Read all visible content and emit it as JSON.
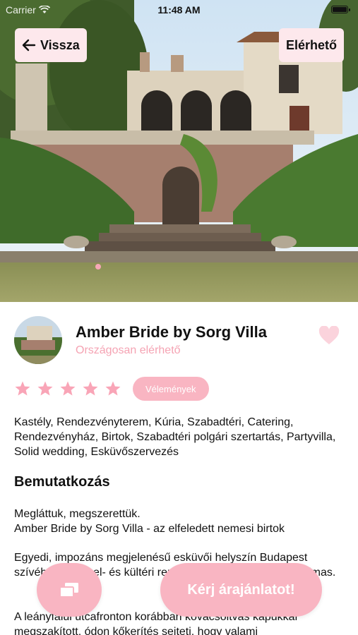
{
  "status_bar": {
    "carrier": "Carrier",
    "time": "11:48 AM"
  },
  "nav": {
    "back_label": "Vissza",
    "availability_label": "Elérhető"
  },
  "vendor": {
    "name": "Amber Bride by Sorg Villa",
    "subtitle": "Országosan elérhető",
    "rating": 5,
    "rating_max": 5,
    "reviews_label": "Vélemények"
  },
  "tags": "Kastély, Rendezvényterem, Kúria, Szabadtéri, Catering, Rendezvényház, Birtok, Szabadtéri polgári szertartás, Partyvilla, Solid wedding, Esküvőszervezés",
  "intro": {
    "title": "Bemutatkozás",
    "paragraphs": [
      "Megláttuk, megszerettük.\nAmber Bride by Sorg Villa - az elfeledett nemesi birtok",
      "Egyedi, impozáns megjelenésű esküvői helyszín Budapest szívében, ami bel- és kültéri rendezvényekre egyaránt alkalmas.",
      "A leányfalui utcafronton korábban kovácsoltvas kapukkal megszakított, ódon kőkerítés sejteti, hogy valami"
    ]
  },
  "actions": {
    "quote_label": "Kérj árajánlatot!"
  },
  "colors": {
    "accent_pink": "#f9b5c2",
    "pale_pink": "#fde8ec",
    "subtitle_pink": "#f5a3b3"
  },
  "icons": [
    "wifi-icon",
    "battery-icon",
    "arrow-left-icon",
    "heart-icon",
    "star-icon",
    "gallery-icon"
  ]
}
